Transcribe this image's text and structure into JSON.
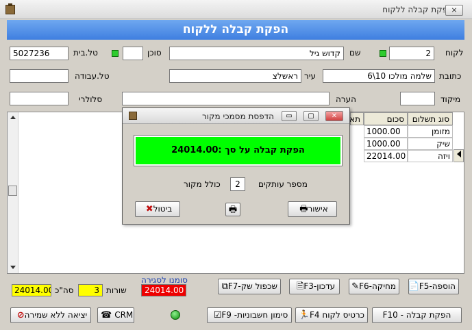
{
  "window": {
    "title": "הפקת קבלה ללקוח",
    "close_glyph": "⨯"
  },
  "banner": {
    "title": "הפקת קבלה ללקוח"
  },
  "customer": {
    "customer_label": "לקוח",
    "customer_value": "2",
    "name_label": "שם",
    "name_value": "קדוש גיל",
    "agent_label": "סוכן",
    "agent_value": "",
    "home_phone_label": "טל.בית",
    "home_phone_value": "5027236",
    "address_label": "כתובת",
    "address_value": "שלמה מולכו 10\\6",
    "city_label": "עיר",
    "city_value": "ראשלצ",
    "work_phone_label": "טל.עבודה",
    "work_phone_value": "",
    "zip_label": "מיקוד",
    "zip_value": "",
    "note_label": "הערה",
    "note_value": "",
    "cell_label": "סלולרי",
    "cell_value": ""
  },
  "table": {
    "headers": [
      "סוג תשלום",
      "סכום",
      "תא"
    ],
    "rows": [
      {
        "type": "מזומן",
        "amount": "1000.00"
      },
      {
        "type": "שיק",
        "amount": "1000.00"
      },
      {
        "type": "ויזה",
        "amount": "22014.00"
      }
    ]
  },
  "dialog": {
    "title": "הדפסת מסמכי מקור",
    "receipt_text": "הפקת קבלה על סך :24014.00",
    "copies_label": "מספר עותקים",
    "copies_value": "2",
    "original_label": "כולל מקור",
    "cancel_label": "ביטול",
    "confirm_label": "אישור",
    "minimize_glyph": "▭",
    "maximize_glyph": "▢",
    "close_glyph": "✕"
  },
  "summary": {
    "closing_label": "סומנו לסגירה",
    "closing_value": "24014.00",
    "rows_label": "שורות",
    "rows_value": "3",
    "total_label": "סה\"כ",
    "total_value": "24014.00"
  },
  "buttons": {
    "add": "הוספה-F5",
    "delete": "מחיקה-F6",
    "update": "עדכון-F3",
    "duplicate_check": "שכפול שק-F7",
    "produce_receipt": "הפקת קבלה - F10",
    "customer_card": "כרטיס לקוח F4",
    "mark_invoices": "סימון חשבוניות- F9",
    "crm": "CRM",
    "exit_no_save": "יציאה ללא שמירה"
  },
  "colors": {
    "banner": "#3f7fe0",
    "green": "#00ff00",
    "yellow": "#ffff00",
    "red": "#ee0000"
  }
}
